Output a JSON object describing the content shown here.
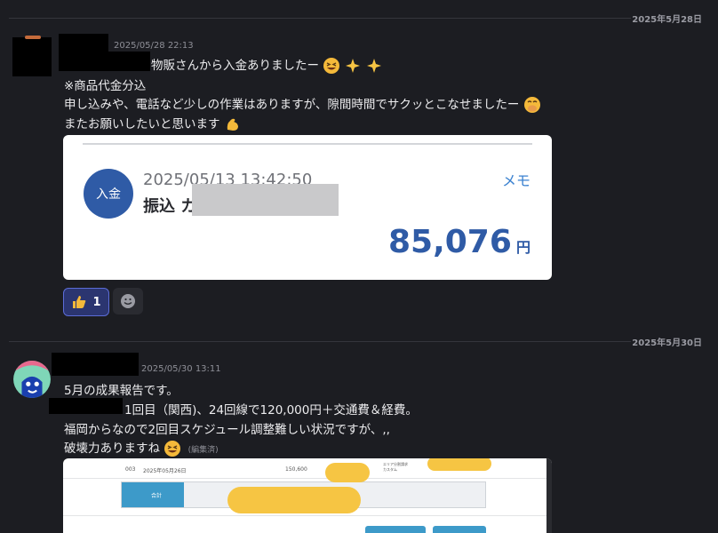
{
  "messages": [
    {
      "date_divider": "2025年5月28日",
      "timestamp": "2025/05/28 22:13",
      "lines": [
        "物販さんから入金ありましたー",
        "※商品代金分込",
        "申し込みや、電話など少しの作業はありますが、隙間時間でサクッとこなせましたー",
        "またお願いしたいと思います"
      ],
      "emoji": [
        "grinning-squint-emoji",
        "sparkles-emoji",
        "sparkles-emoji",
        "hand-over-mouth-emoji",
        "flexed-biceps-emoji"
      ],
      "attachment": {
        "badge": "入金",
        "datetime": "2025/05/13 13:42:50",
        "memo_label": "メモ",
        "transfer_label": "振込 カ",
        "amount": "85,076",
        "currency": "円",
        "accent_color": "#2f5ba6"
      },
      "reactions": [
        {
          "icon": "thumbs-up-icon",
          "count": "1"
        },
        {
          "icon": "add-reaction-icon"
        }
      ]
    },
    {
      "date_divider": "2025年5月30日",
      "timestamp": "2025/05/30 13:11",
      "lines": [
        "5月の成果報告です。",
        "1回目（関西)、24回線で120,000円＋交通費＆経費。",
        "福岡からなので2回目スケジュール調整難しい状況ですが、,,",
        "破壊力ありますね"
      ],
      "edited_label": "(編集済)",
      "attachment": {
        "row_no": "003",
        "row_date": "2025年05月26日",
        "row_amount": "150,600",
        "row_tag": "エリア分割請求\nカスタム",
        "sum_label": "合計"
      }
    }
  ]
}
